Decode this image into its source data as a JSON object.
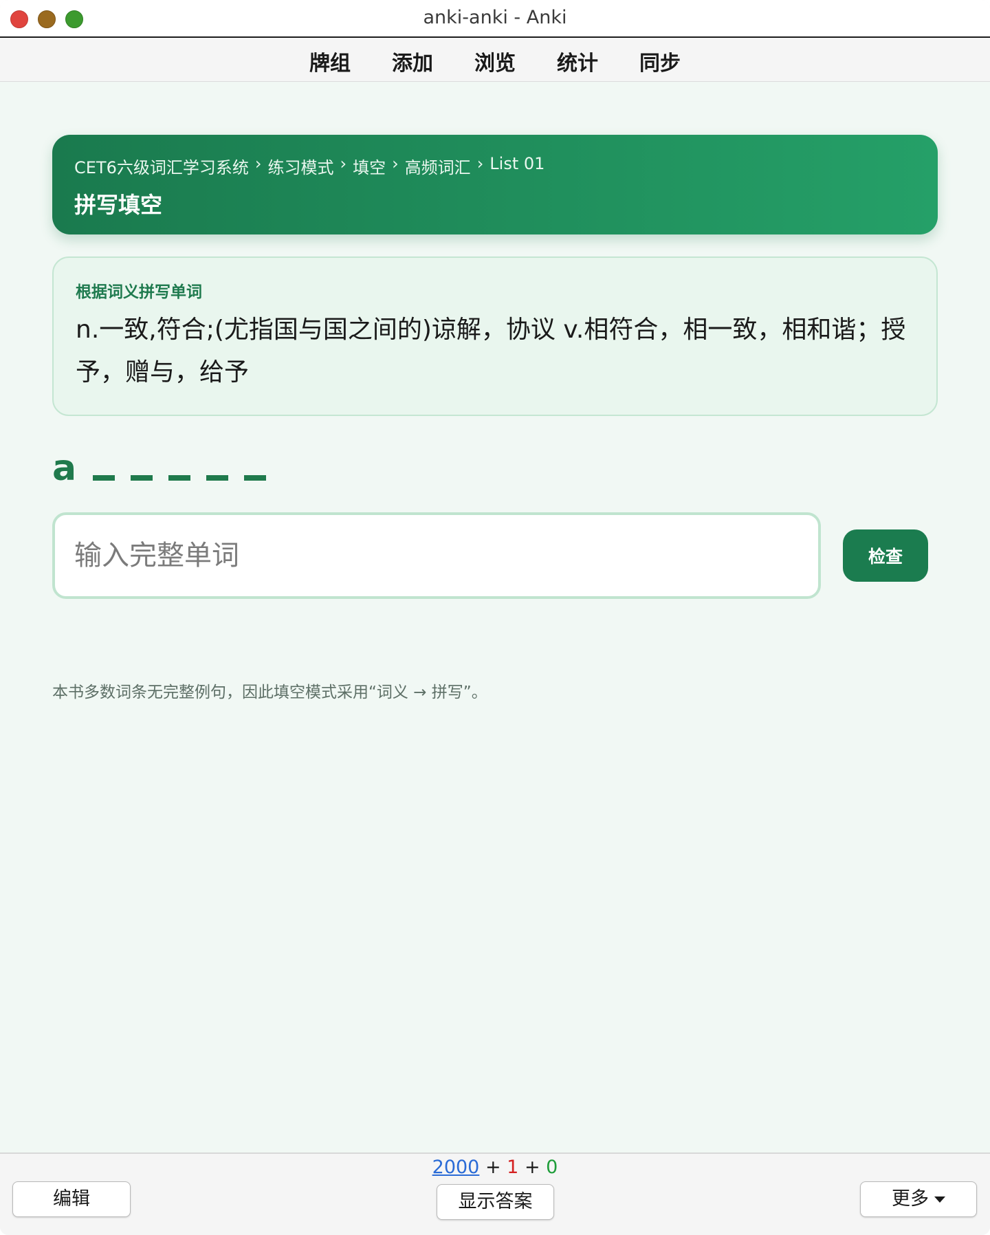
{
  "window": {
    "title": "anki-anki - Anki"
  },
  "toolbar": {
    "items": [
      "牌组",
      "添加",
      "浏览",
      "统计",
      "同步"
    ]
  },
  "header": {
    "breadcrumb": [
      "CET6六级词汇学习系统",
      "练习模式",
      "填空",
      "高频词汇",
      "List 01"
    ],
    "breadcrumb_separator": "›",
    "title": "拼写填空"
  },
  "meaning": {
    "label": "根据词义拼写单词",
    "text": "n.一致,符合;(尤指国与国之间的)谅解，协议 v.相符合，相一致，相和谐；授予，赠与，给予"
  },
  "hint": {
    "first_letter": "a",
    "blank_count": 5
  },
  "answer": {
    "placeholder": "输入完整单词",
    "value": ""
  },
  "check_button": {
    "label": "检查"
  },
  "note": "本书多数词条无完整例句，因此填空模式采用“词义 → 拼写”。",
  "bottom": {
    "counts": {
      "new": "2000",
      "learn": "1",
      "review": "0",
      "plus": "+"
    },
    "edit_label": "编辑",
    "show_answer_label": "显示答案",
    "more_label": "更多"
  },
  "colors": {
    "accent": "#1b7c4f",
    "header_gradient_start": "#1a7a4e",
    "header_gradient_end": "#25a068",
    "background": "#f1f8f4",
    "count_new": "#2a6bd6",
    "count_learn": "#d42020",
    "count_review": "#1f9d3a"
  }
}
